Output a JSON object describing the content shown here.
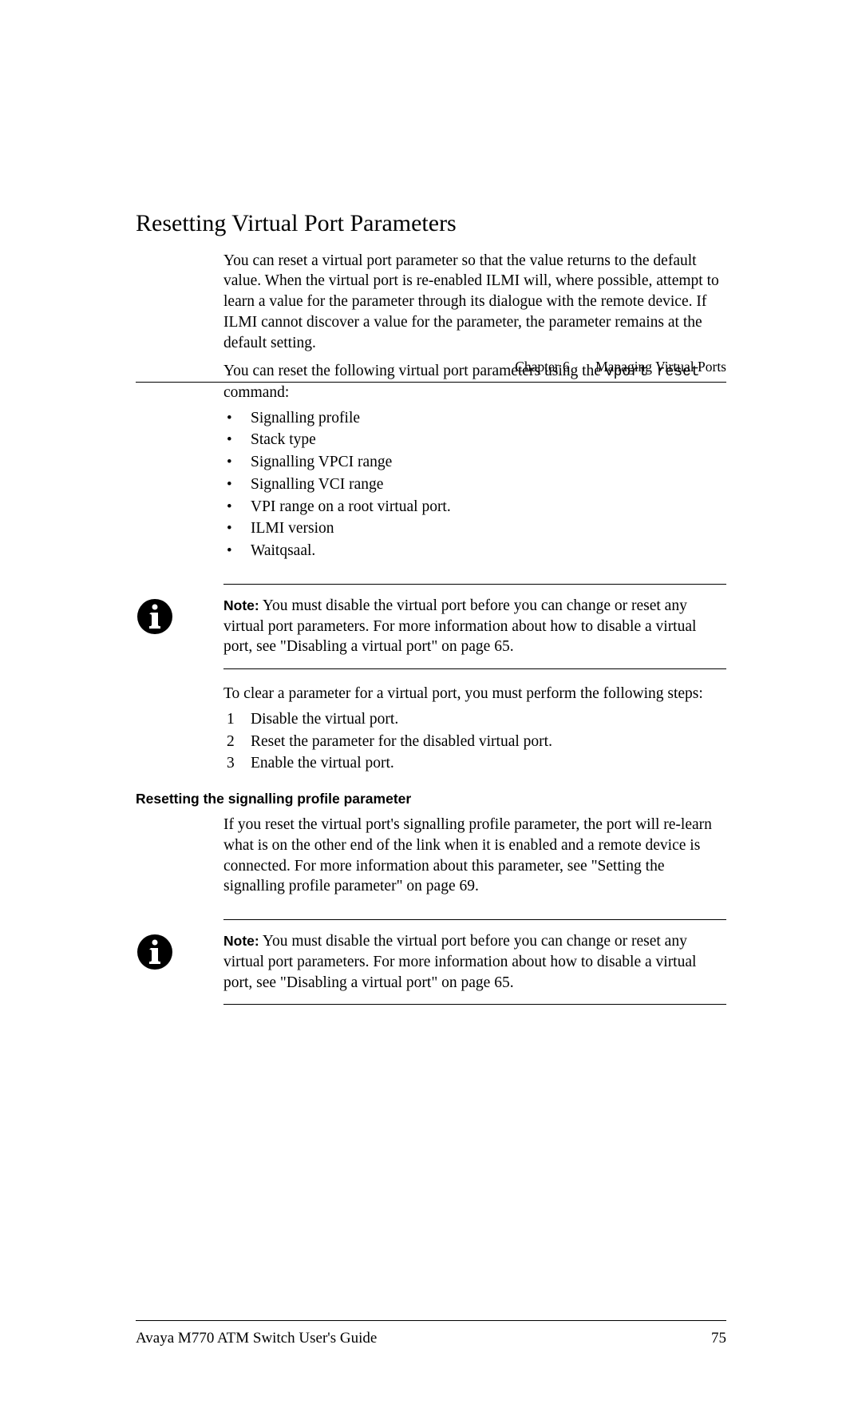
{
  "header": {
    "chapter": "Chapter 6",
    "title": "Managing Virtual Ports"
  },
  "h1": "Resetting Virtual Port Parameters",
  "intro1": "You can reset a virtual port parameter so that the value returns to the default value. When the virtual port is re-enabled ILMI will, where possible, attempt to learn a value for the parameter through its dialogue with the remote device. If ILMI cannot discover a value for the parameter, the parameter remains at the default setting.",
  "intro2_a": "You can reset the following virtual port parameters using the ",
  "intro2_cmd": "vport reset",
  "intro2_b": " command:",
  "bullets": [
    "Signalling profile",
    "Stack type",
    "Signalling VPCI range",
    "Signalling VCI range",
    "VPI range on a root virtual port.",
    "ILMI version",
    "Waitqsaal."
  ],
  "note1": {
    "label": "Note:",
    "text": " You must disable the virtual port before you can change or reset any virtual port parameters. For more information about how to disable a virtual port, see \"Disabling a virtual port\" on page 65."
  },
  "stepsLead": "To clear a parameter for a virtual port, you must perform the following steps:",
  "steps": [
    "Disable the virtual port.",
    "Reset the parameter for the disabled virtual port.",
    "Enable the virtual port."
  ],
  "h2": "Resetting the signalling profile parameter",
  "profilePara": "If you reset the virtual port's signalling profile parameter, the port will re-learn what is on the other end of the link when it is enabled and a remote device is connected. For more information about this parameter, see \"Setting the signalling profile parameter\" on page 69.",
  "note2": {
    "label": "Note:",
    "text": " You must disable the virtual port before you can change or reset any virtual port parameters. For more information about how to disable a virtual port, see \"Disabling a virtual port\" on page 65."
  },
  "footer": {
    "text": "Avaya M770 ATM Switch User's Guide",
    "page": "75"
  }
}
